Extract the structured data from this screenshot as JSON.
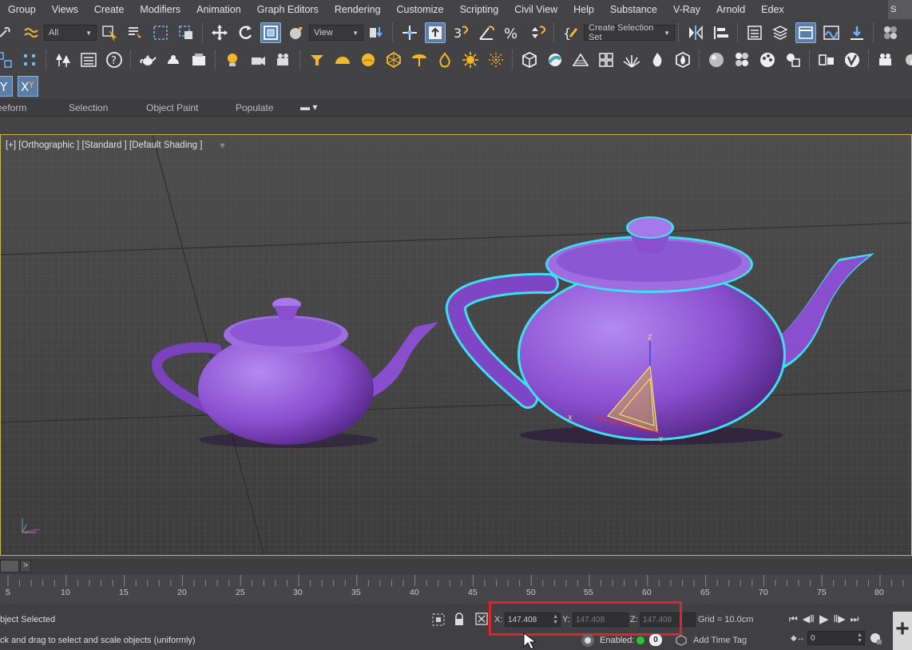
{
  "menu": {
    "items": [
      "Group",
      "Views",
      "Create",
      "Modifiers",
      "Animation",
      "Graph Editors",
      "Rendering",
      "Customize",
      "Scripting",
      "Civil View",
      "Help",
      "Substance",
      "V-Ray",
      "Arnold",
      "Edex"
    ],
    "corner_label": "S"
  },
  "toolbar_main": {
    "filter_dropdown": "All",
    "coord_system_dropdown": "View",
    "selection_set_dropdown": "Create Selection Set"
  },
  "ribbon": {
    "tabs": [
      "eeform",
      "Selection",
      "Object Paint",
      "Populate"
    ]
  },
  "viewport": {
    "label": "[+] [Orthographic ] [Standard ] [Default Shading ]",
    "gizmo_axes": [
      "Z",
      "X",
      "Y"
    ]
  },
  "timeline": {
    "next_button": ">",
    "ticks": [
      "5",
      "10",
      "15",
      "20",
      "25",
      "30",
      "35",
      "40",
      "45",
      "50",
      "55",
      "60",
      "65",
      "70",
      "75",
      "80"
    ]
  },
  "status": {
    "selection_text": "bject Selected",
    "prompt_text": "ck and drag to select and scale objects (uniformly)",
    "x_label": "X:",
    "x_value": "147.408",
    "y_label": "Y:",
    "y_value": "147.408",
    "z_label": "Z:",
    "z_value": "147.408",
    "grid_text": "Grid = 10.0cm",
    "enabled_label": "Enabled:",
    "enabled_count": "0",
    "add_time_tag": "Add Time Tag",
    "frame_value": "0"
  },
  "colors": {
    "teapot": "#8a4fcf",
    "selection_outline": "#3ee0f0",
    "highlight": "#e2232e",
    "viewport_border": "#c8b44a"
  }
}
